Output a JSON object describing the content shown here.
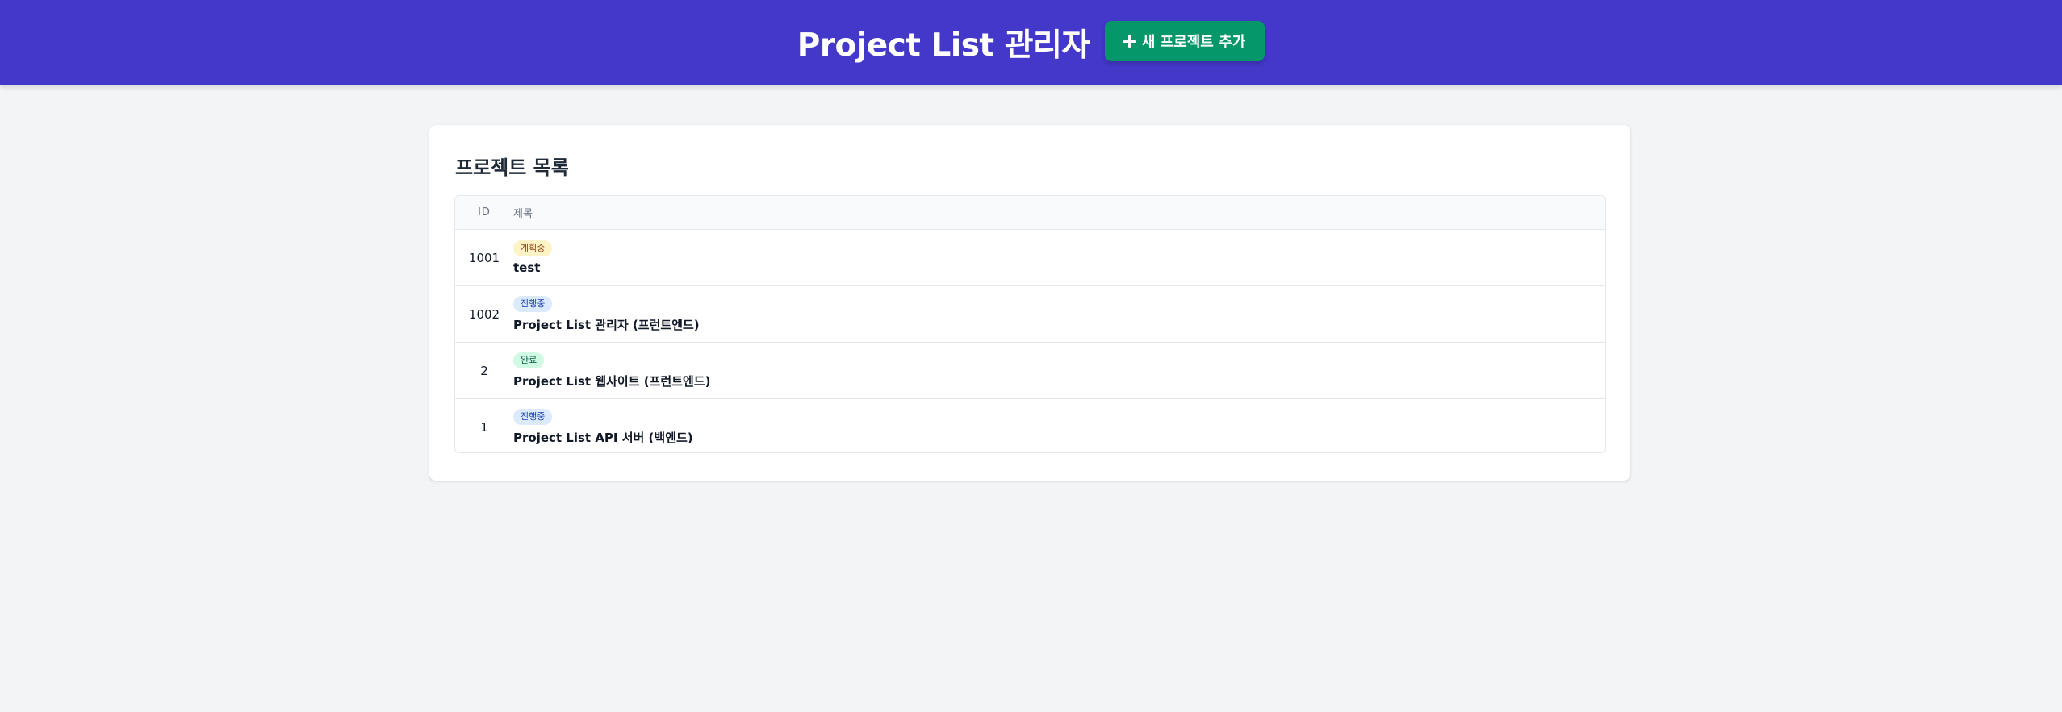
{
  "header": {
    "title": "Project List 관리자",
    "add_button_label": "새 프로젝트 추가",
    "background_color": "#4338ca",
    "button_color": "#059669"
  },
  "main": {
    "card_title": "프로젝트 목록",
    "table": {
      "columns": [
        "ID",
        "제목"
      ],
      "rows": [
        {
          "id": "1001",
          "status": "계획중",
          "status_type": "planning",
          "title": "test"
        },
        {
          "id": "1002",
          "status": "진행중",
          "status_type": "progress",
          "title": "Project List 관리자 (프런트엔드)"
        },
        {
          "id": "2",
          "status": "완료",
          "status_type": "done",
          "title": "Project List 웹사이트 (프런트엔드)"
        },
        {
          "id": "1",
          "status": "진행중",
          "status_type": "progress",
          "title": "Project List API 서버 (백엔드)"
        }
      ]
    }
  },
  "status_colors": {
    "planning": "#fef3c7",
    "progress": "#dbeafe",
    "done": "#d1fae5"
  }
}
